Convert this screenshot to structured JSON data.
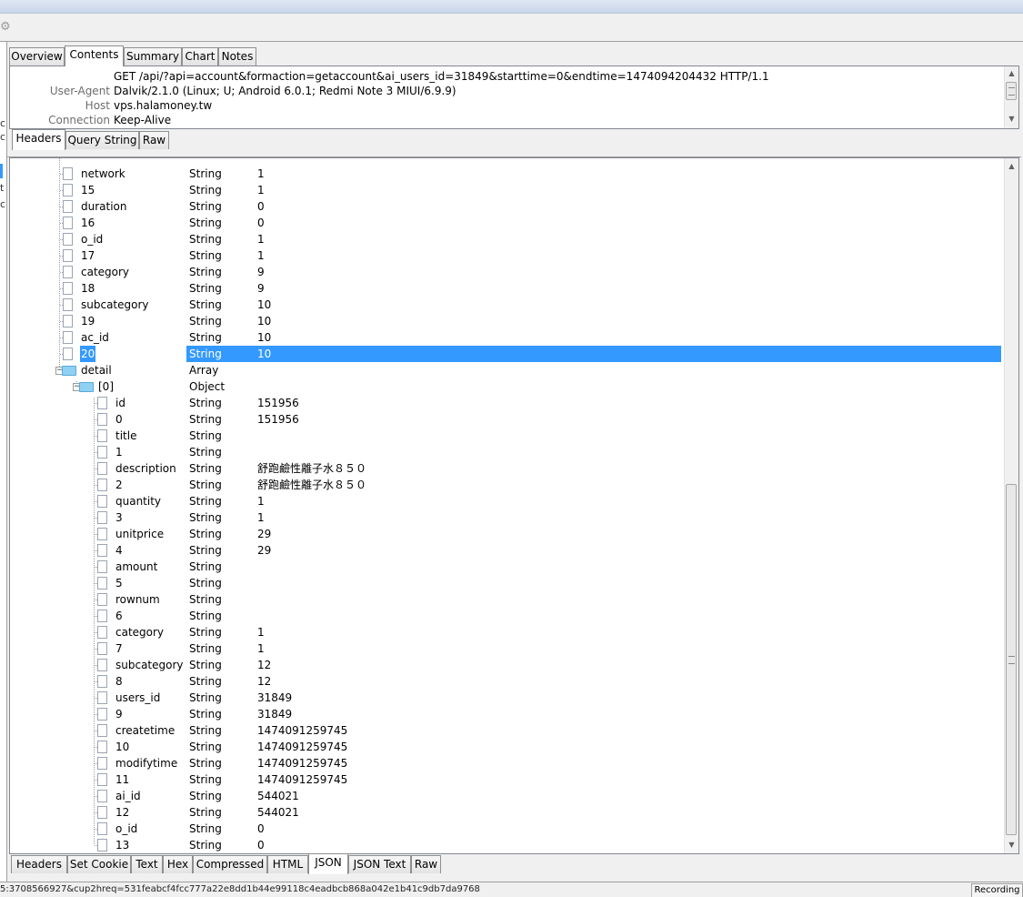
{
  "top_tabs": [
    "Overview",
    "Contents",
    "Summary",
    "Chart",
    "Notes"
  ],
  "request_headers": [
    {
      "key": "",
      "value": "GET /api/?api=account&formaction=getaccount&ai_users_id=31849&starttime=0&endtime=1474094204432 HTTP/1.1"
    },
    {
      "key": "User-Agent",
      "value": "Dalvik/2.1.0 (Linux; U; Android 6.0.1; Redmi Note 3 MIUI/6.9.9)"
    },
    {
      "key": "Host",
      "value": "vps.halamoney.tw"
    },
    {
      "key": "Connection",
      "value": "Keep-Alive"
    }
  ],
  "request_tabs": [
    "Headers",
    "Query String",
    "Raw"
  ],
  "tree_rows": [
    {
      "name": "network",
      "type": "String",
      "value": "1"
    },
    {
      "name": "15",
      "type": "String",
      "value": "1"
    },
    {
      "name": "duration",
      "type": "String",
      "value": "0"
    },
    {
      "name": "16",
      "type": "String",
      "value": "0"
    },
    {
      "name": "o_id",
      "type": "String",
      "value": "1"
    },
    {
      "name": "17",
      "type": "String",
      "value": "1"
    },
    {
      "name": "category",
      "type": "String",
      "value": "9"
    },
    {
      "name": "18",
      "type": "String",
      "value": "9"
    },
    {
      "name": "subcategory",
      "type": "String",
      "value": "10"
    },
    {
      "name": "19",
      "type": "String",
      "value": "10"
    },
    {
      "name": "ac_id",
      "type": "String",
      "value": "10"
    },
    {
      "name": "20",
      "type": "String",
      "value": "10"
    },
    {
      "name": "detail",
      "type": "Array",
      "value": ""
    },
    {
      "name": "[0]",
      "type": "Object",
      "value": ""
    },
    {
      "name": "id",
      "type": "String",
      "value": "151956"
    },
    {
      "name": "0",
      "type": "String",
      "value": "151956"
    },
    {
      "name": "title",
      "type": "String",
      "value": ""
    },
    {
      "name": "1",
      "type": "String",
      "value": ""
    },
    {
      "name": "description",
      "type": "String",
      "value": "舒跑鹼性離子水８５０"
    },
    {
      "name": "2",
      "type": "String",
      "value": "舒跑鹼性離子水８５０"
    },
    {
      "name": "quantity",
      "type": "String",
      "value": "1"
    },
    {
      "name": "3",
      "type": "String",
      "value": "1"
    },
    {
      "name": "unitprice",
      "type": "String",
      "value": "29"
    },
    {
      "name": "4",
      "type": "String",
      "value": "29"
    },
    {
      "name": "amount",
      "type": "String",
      "value": ""
    },
    {
      "name": "5",
      "type": "String",
      "value": ""
    },
    {
      "name": "rownum",
      "type": "String",
      "value": ""
    },
    {
      "name": "6",
      "type": "String",
      "value": ""
    },
    {
      "name": "category",
      "type": "String",
      "value": "1"
    },
    {
      "name": "7",
      "type": "String",
      "value": "1"
    },
    {
      "name": "subcategory",
      "type": "String",
      "value": "12"
    },
    {
      "name": "8",
      "type": "String",
      "value": "12"
    },
    {
      "name": "users_id",
      "type": "String",
      "value": "31849"
    },
    {
      "name": "9",
      "type": "String",
      "value": "31849"
    },
    {
      "name": "createtime",
      "type": "String",
      "value": "1474091259745"
    },
    {
      "name": "10",
      "type": "String",
      "value": "1474091259745"
    },
    {
      "name": "modifytime",
      "type": "String",
      "value": "1474091259745"
    },
    {
      "name": "11",
      "type": "String",
      "value": "1474091259745"
    },
    {
      "name": "ai_id",
      "type": "String",
      "value": "544021"
    },
    {
      "name": "12",
      "type": "String",
      "value": "544021"
    },
    {
      "name": "o_id",
      "type": "String",
      "value": "0"
    },
    {
      "name": "13",
      "type": "String",
      "value": "0"
    }
  ],
  "response_tabs": [
    "Headers",
    "Set Cookie",
    "Text",
    "Hex",
    "Compressed",
    "HTML",
    "JSON",
    "JSON Text",
    "Raw"
  ],
  "status": {
    "url_text": "5:3708566927&cup2hreq=531feabcf4fcc777a22e8dd1b44e99118c4eadbcb868a042e1b41c9db7da9768",
    "recording": "Recording"
  },
  "colors": {
    "selection": "#3399ff",
    "folder": "#8fd1f5"
  },
  "icons": [
    "gear-icon",
    "file-icon",
    "folder-icon",
    "collapse-icon",
    "scroll-up-icon",
    "scroll-down-icon"
  ]
}
